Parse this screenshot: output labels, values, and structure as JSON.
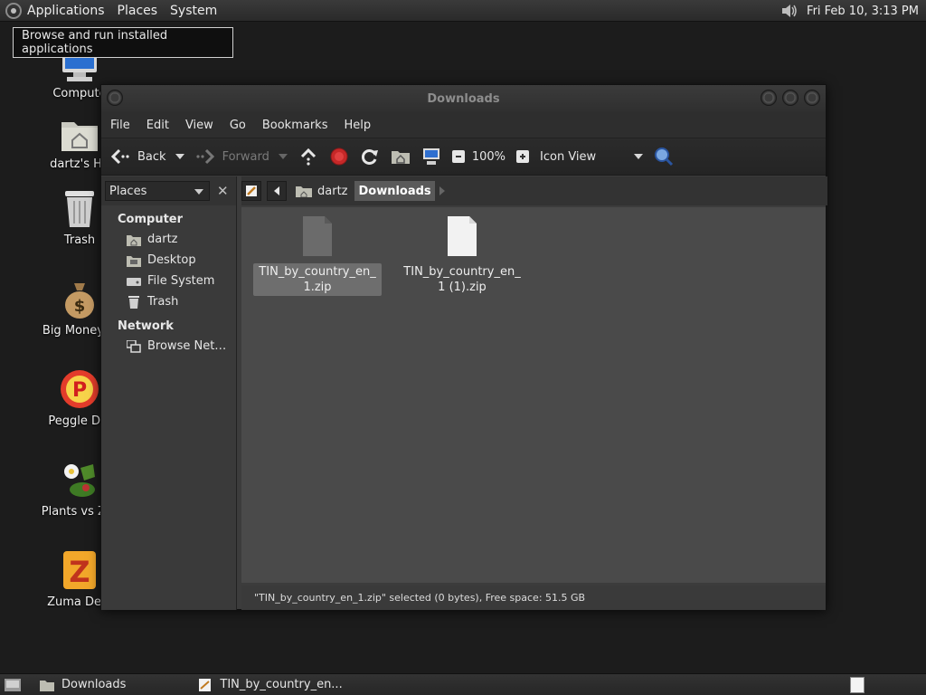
{
  "top_panel": {
    "menus": [
      "Applications",
      "Places",
      "System"
    ],
    "clock": "Fri Feb 10,  3:13 PM",
    "volume_icon": "volume-icon"
  },
  "tooltip": "Browse and run installed applications",
  "desktop_icons": [
    {
      "label": "Compute",
      "icon": "computer-icon"
    },
    {
      "label": "dartz's Ho",
      "icon": "home-folder-icon"
    },
    {
      "label": "Trash",
      "icon": "trash-icon"
    },
    {
      "label": "Big Money D",
      "icon": "money-bag-icon"
    },
    {
      "label": "Peggle Del",
      "icon": "peggle-icon"
    },
    {
      "label": "Plants vs Zor",
      "icon": "plants-vs-zombies-icon"
    },
    {
      "label": "Zuma Delu",
      "icon": "zuma-icon"
    }
  ],
  "window": {
    "title": "Downloads",
    "menubar": [
      "File",
      "Edit",
      "View",
      "Go",
      "Bookmarks",
      "Help"
    ],
    "toolbar": {
      "back": "Back",
      "forward": "Forward",
      "zoom": "100%",
      "view_mode": "Icon View"
    },
    "sidebar": {
      "selector": "Places",
      "sections": [
        {
          "title": "Computer",
          "items": [
            "dartz",
            "Desktop",
            "File System",
            "Trash"
          ]
        },
        {
          "title": "Network",
          "items": [
            "Browse Net…"
          ]
        }
      ]
    },
    "pathbar": [
      "dartz",
      "Downloads"
    ],
    "files": [
      {
        "name": "TIN_by_country_en_1.zip",
        "selected": true
      },
      {
        "name": "TIN_by_country_en_1 (1).zip",
        "selected": false
      }
    ],
    "status": "\"TIN_by_country_en_1.zip\" selected (0 bytes), Free space: 51.5 GB"
  },
  "bottom_panel": {
    "tasks": [
      "Downloads",
      "TIN_by_country_en..."
    ]
  }
}
